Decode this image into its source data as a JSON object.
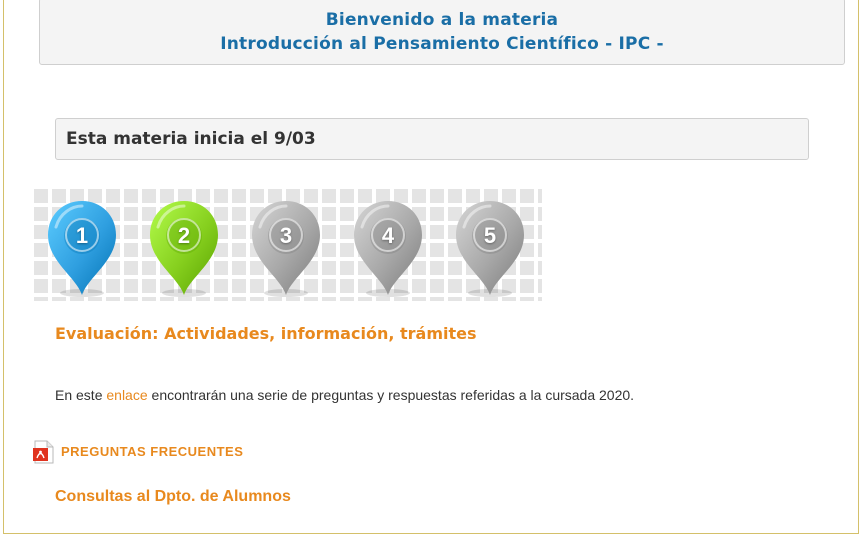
{
  "welcome": {
    "line1": "Bienvenido a la materia",
    "line2": "Introducción al Pensamiento Científico - IPC -"
  },
  "start_notice": "Esta materia inicia el 9/03",
  "steps": [
    {
      "label": "1",
      "color": "#2f9fe0",
      "active": true
    },
    {
      "label": "2",
      "color": "#86cf1e",
      "active": true
    },
    {
      "label": "3",
      "color": "#a8a8a8",
      "active": false
    },
    {
      "label": "4",
      "color": "#a8a8a8",
      "active": false
    },
    {
      "label": "5",
      "color": "#a8a8a8",
      "active": false
    }
  ],
  "evaluation_heading": "Evaluación: Actividades, información, trámites",
  "info": {
    "prefix": "En este ",
    "link": "enlace",
    "suffix": " encontrarán una serie de preguntas y respuestas referidas a la cursada 2020."
  },
  "faq": {
    "icon": "pdf-icon",
    "label": "PREGUNTAS FRECUENTES"
  },
  "consultas_link": "Consultas al Dpto. de Alumnos",
  "colors": {
    "accent": "#e8891e",
    "title_blue": "#1a6ea6"
  }
}
